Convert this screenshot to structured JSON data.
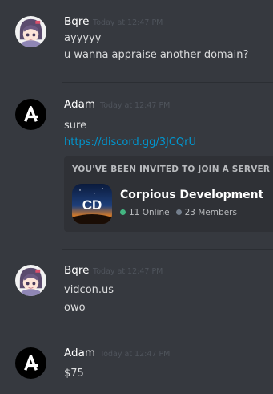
{
  "messages": [
    {
      "author": "Bqre",
      "timestamp": "Today at 12:47 PM",
      "lines": [
        "ayyyyy",
        "u wanna appraise another domain?"
      ]
    },
    {
      "author": "Adam",
      "timestamp": "Today at 12:47 PM",
      "lines": [
        "sure"
      ],
      "link": "https://discord.gg/3JCQrU",
      "invite": {
        "heading": "YOU'VE BEEN INVITED TO JOIN A SERVER",
        "server_name": "Corpious Development",
        "server_icon_text": "CD",
        "online": "11 Online",
        "members": "23 Members"
      }
    },
    {
      "author": "Bqre",
      "timestamp": "Today at 12:47 PM",
      "lines": [
        "vidcon.us",
        "owo"
      ]
    },
    {
      "author": "Adam",
      "timestamp": "Today at 12:47 PM",
      "lines": [
        "$75"
      ]
    }
  ],
  "colors": {
    "background": "#36393f",
    "link": "#0096cf",
    "online": "#43b581",
    "members": "#747f8d",
    "timestamp": "#4f545c"
  }
}
